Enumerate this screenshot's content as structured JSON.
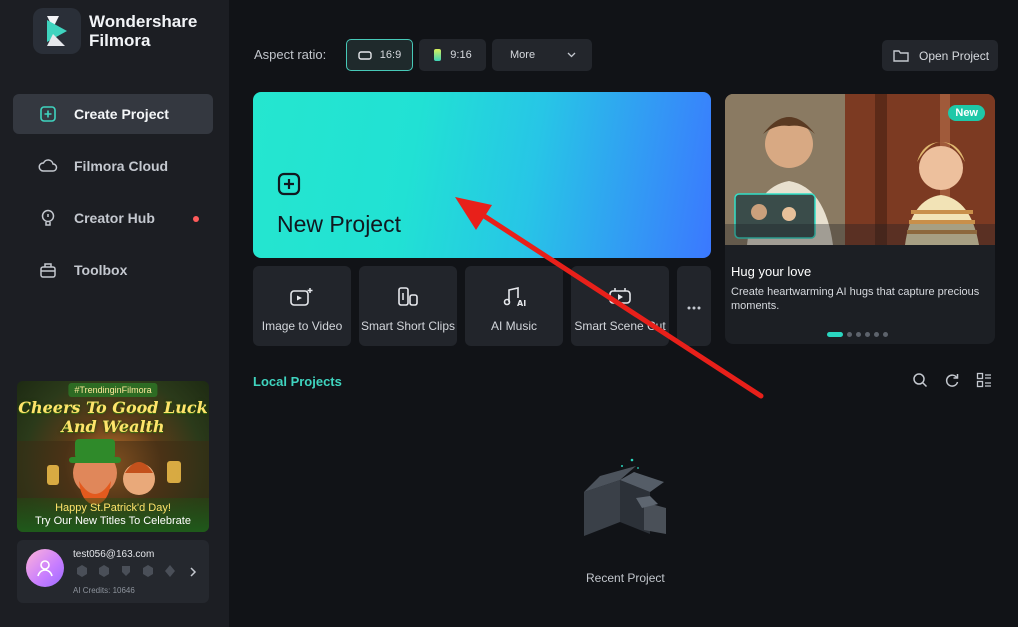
{
  "app": {
    "name_line1": "Wondershare",
    "name_line2": "Filmora"
  },
  "sidebar": {
    "items": [
      {
        "label": "Create Project",
        "icon": "plus-square-icon",
        "active": true
      },
      {
        "label": "Filmora Cloud",
        "icon": "cloud-icon"
      },
      {
        "label": "Creator Hub",
        "icon": "bulb-icon",
        "has_dot": true
      },
      {
        "label": "Toolbox",
        "icon": "toolbox-icon"
      }
    ],
    "promo": {
      "tag": "#TrendinginFilmora",
      "headline_line1": "Cheers To Good Luck",
      "headline_line2": "And Wealth",
      "sub_line1": "Happy St.Patrick'd Day!",
      "sub_line2": "Try Our New Titles To Celebrate"
    },
    "account": {
      "email": "test056@163.com",
      "credits": "AI Credits: 10646"
    }
  },
  "topbar": {
    "aspect_label": "Aspect ratio:",
    "ratios": [
      {
        "label": "16:9",
        "selected": true
      },
      {
        "label": "9:16",
        "selected": false
      }
    ],
    "more_label": "More",
    "open_project": "Open Project"
  },
  "new_project": {
    "title": "New Project"
  },
  "tools": [
    {
      "label": "Image to Video",
      "icon": "image-to-video-icon"
    },
    {
      "label": "Smart Short Clips",
      "icon": "smart-short-clips-icon"
    },
    {
      "label": "AI Music",
      "icon": "ai-music-icon"
    },
    {
      "label": "Smart Scene Cut",
      "icon": "smart-scene-cut-icon"
    }
  ],
  "feature": {
    "badge": "New",
    "title": "Hug your love",
    "description": "Create heartwarming AI hugs that capture precious moments.",
    "slide_count": 6,
    "active_slide": 1
  },
  "local_projects": {
    "title": "Local Projects",
    "empty_text": "Recent Project"
  },
  "colors": {
    "accent": "#2ad6c0",
    "background": "#111317",
    "sidebar": "#1c1e23",
    "annotation_arrow": "#e8201a"
  }
}
